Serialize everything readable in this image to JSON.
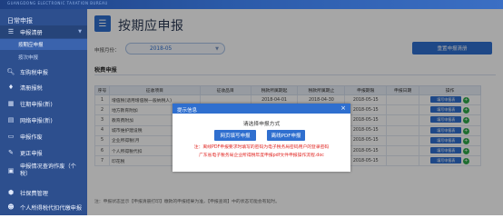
{
  "banner": {
    "subtitle": "GUANGDONG ELECTRONIC TAXATION BUREAU"
  },
  "sidebar": {
    "title": "日常申报",
    "items": [
      {
        "label": "申报清册",
        "icon": "list-icon",
        "expanded": true
      },
      {
        "label": "车购税申报",
        "icon": "car-icon"
      },
      {
        "label": "清册报税",
        "icon": "tax-icon"
      },
      {
        "label": "往期申报(新)",
        "icon": "calendar-icon"
      },
      {
        "label": "网络申报(新)",
        "icon": "network-icon"
      },
      {
        "label": "申报作废",
        "icon": "doc-icon"
      },
      {
        "label": "更正申报",
        "icon": "edit-icon"
      },
      {
        "label": "申报情况查询作废（个税）",
        "icon": "search-doc-icon"
      },
      {
        "label": "社保费管理",
        "icon": "shield-icon"
      },
      {
        "label": "个人所得税代扣代缴申报",
        "icon": "person-icon"
      }
    ],
    "subitems": [
      {
        "label": "按期应申报",
        "active": true
      },
      {
        "label": "按次申报",
        "active": false
      }
    ]
  },
  "header": {
    "title": "按期应申报"
  },
  "filter": {
    "month_label": "申报月份：",
    "month_value": "2018-05",
    "refresh_button": "重置申报清册"
  },
  "section": {
    "title": "税费申报"
  },
  "table": {
    "headers": [
      "序号",
      "征收项目",
      "征收品目",
      "税款所属期起",
      "税款所属期止",
      "申报期限",
      "申报日期",
      "操作"
    ],
    "rows": [
      {
        "no": "1",
        "item": "增值税(适用增值税一般纳税人)",
        "start": "2018-04-01",
        "end": "2018-04-30",
        "deadline": "2018-05-15",
        "date": "",
        "action": "填写申报表"
      },
      {
        "no": "2",
        "item": "地方教育附加",
        "start": "",
        "end": "",
        "deadline": "2018-05-15",
        "date": "",
        "action": "填写申报表"
      },
      {
        "no": "3",
        "item": "教育费附加",
        "start": "",
        "end": "",
        "deadline": "2018-05-15",
        "date": "",
        "action": "填写申报表"
      },
      {
        "no": "4",
        "item": "城市维护建设税",
        "start": "",
        "end": "",
        "deadline": "2018-05-15",
        "date": "",
        "action": "填写申报表"
      },
      {
        "no": "5",
        "item": "企业所得税(月",
        "start": "",
        "end": "",
        "deadline": "2018-05-15",
        "date": "",
        "action": "填写申报表"
      },
      {
        "no": "6",
        "item": "个人所得税代扣",
        "start": "",
        "end": "",
        "deadline": "2018-05-15",
        "date": "",
        "action": "填写申报表"
      },
      {
        "no": "7",
        "item": "印花税",
        "item2": "购销合同",
        "start": "2018-04-01",
        "end": "2018-04-30",
        "deadline": "2018-05-15",
        "date": "",
        "action": "填写申报表"
      }
    ]
  },
  "note": "注：申报状态显示【申报清册打印】缴款的申报结果为准，【申报查询】中的状态可能会有延时。",
  "modal": {
    "title": "提示信息",
    "message": "请选择申报方式",
    "online_button": "网页填写申报",
    "pdf_button": "离线PDF申报",
    "note1": "注：离线PDF申报要求时填写的密码为电子税务局密码用户的登录密码",
    "note2": "广东省电子税务局企业所得税年度申报pdf文件申报操作流程.doc"
  },
  "colors": {
    "sidebar": "#2d4f8e",
    "accent": "#2f6fcf",
    "warning": "#e0231f",
    "add": "#2eaa4a"
  }
}
